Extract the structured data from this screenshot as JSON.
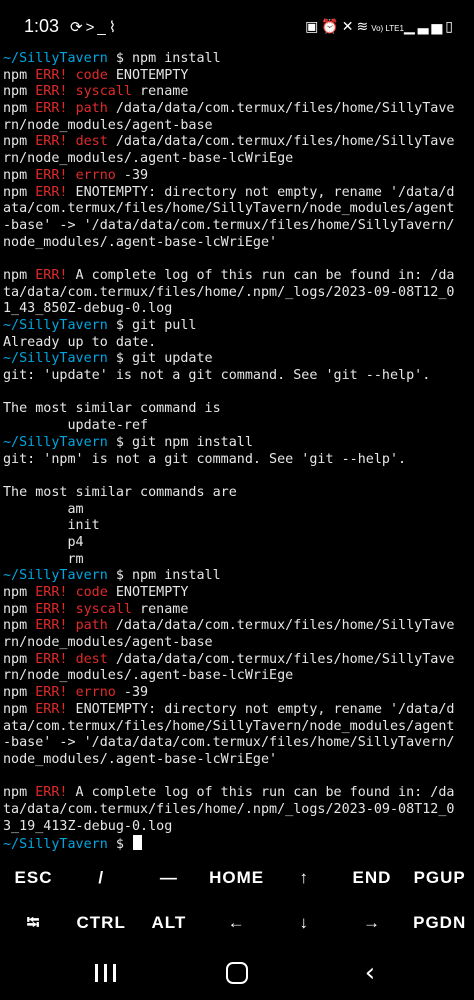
{
  "status_bar": {
    "time": "1:03",
    "left_icons": [
      "sync-icon",
      "terminal-icon",
      "paperclip-icon"
    ],
    "right_icons": [
      "battery-saver-icon",
      "alarm-icon",
      "mute-icon",
      "wifi-icon",
      "volte-icon",
      "signal-icon",
      "battery-icon"
    ],
    "network_label": "Vo) LTE1"
  },
  "terminal": {
    "prompt_path": "~/SillyTavern",
    "lines": [
      [
        {
          "t": "~/SillyTavern",
          "c": "prompt-path"
        },
        {
          "t": " $ npm install"
        }
      ],
      [
        {
          "t": "npm "
        },
        {
          "t": "ERR!",
          "c": "err-tag"
        },
        {
          "t": " "
        },
        {
          "t": "code",
          "c": "err-tag"
        },
        {
          "t": " ENOTEMPTY"
        }
      ],
      [
        {
          "t": "npm "
        },
        {
          "t": "ERR!",
          "c": "err-tag"
        },
        {
          "t": " "
        },
        {
          "t": "syscall",
          "c": "err-tag"
        },
        {
          "t": " rename"
        }
      ],
      [
        {
          "t": "npm "
        },
        {
          "t": "ERR!",
          "c": "err-tag"
        },
        {
          "t": " "
        },
        {
          "t": "path",
          "c": "err-tag"
        },
        {
          "t": " /data/data/com.termux/files/home/SillyTave"
        }
      ],
      [
        {
          "t": "rn/node_modules/agent-base"
        }
      ],
      [
        {
          "t": "npm "
        },
        {
          "t": "ERR!",
          "c": "err-tag"
        },
        {
          "t": " "
        },
        {
          "t": "dest",
          "c": "err-tag"
        },
        {
          "t": " /data/data/com.termux/files/home/SillyTave"
        }
      ],
      [
        {
          "t": "rn/node_modules/.agent-base-lcWriEge"
        }
      ],
      [
        {
          "t": "npm "
        },
        {
          "t": "ERR!",
          "c": "err-tag"
        },
        {
          "t": " "
        },
        {
          "t": "errno",
          "c": "err-tag"
        },
        {
          "t": " -39"
        }
      ],
      [
        {
          "t": "npm "
        },
        {
          "t": "ERR!",
          "c": "err-tag"
        },
        {
          "t": " ENOTEMPTY: directory not empty, rename '/data/d"
        }
      ],
      [
        {
          "t": "ata/com.termux/files/home/SillyTavern/node_modules/agent"
        }
      ],
      [
        {
          "t": "-base' -> '/data/data/com.termux/files/home/SillyTavern/"
        }
      ],
      [
        {
          "t": "node_modules/.agent-base-lcWriEge'"
        }
      ],
      [
        {
          "t": ""
        }
      ],
      [
        {
          "t": "npm "
        },
        {
          "t": "ERR!",
          "c": "err-tag"
        },
        {
          "t": " A complete log of this run can be found in: /da"
        }
      ],
      [
        {
          "t": "ta/data/com.termux/files/home/.npm/_logs/2023-09-08T12_0"
        }
      ],
      [
        {
          "t": "1_43_850Z-debug-0.log"
        }
      ],
      [
        {
          "t": "~/SillyTavern",
          "c": "prompt-path"
        },
        {
          "t": " $ git pull"
        }
      ],
      [
        {
          "t": "Already up to date."
        }
      ],
      [
        {
          "t": "~/SillyTavern",
          "c": "prompt-path"
        },
        {
          "t": " $ git update"
        }
      ],
      [
        {
          "t": "git: 'update' is not a git command. See 'git --help'."
        }
      ],
      [
        {
          "t": ""
        }
      ],
      [
        {
          "t": "The most similar command is"
        }
      ],
      [
        {
          "t": "        update-ref"
        }
      ],
      [
        {
          "t": "~/SillyTavern",
          "c": "prompt-path"
        },
        {
          "t": " $ git npm install"
        }
      ],
      [
        {
          "t": "git: 'npm' is not a git command. See 'git --help'."
        }
      ],
      [
        {
          "t": ""
        }
      ],
      [
        {
          "t": "The most similar commands are"
        }
      ],
      [
        {
          "t": "        am"
        }
      ],
      [
        {
          "t": "        init"
        }
      ],
      [
        {
          "t": "        p4"
        }
      ],
      [
        {
          "t": "        rm"
        }
      ],
      [
        {
          "t": "~/SillyTavern",
          "c": "prompt-path"
        },
        {
          "t": " $ npm install"
        }
      ],
      [
        {
          "t": "npm "
        },
        {
          "t": "ERR!",
          "c": "err-tag"
        },
        {
          "t": " "
        },
        {
          "t": "code",
          "c": "err-tag"
        },
        {
          "t": " ENOTEMPTY"
        }
      ],
      [
        {
          "t": "npm "
        },
        {
          "t": "ERR!",
          "c": "err-tag"
        },
        {
          "t": " "
        },
        {
          "t": "syscall",
          "c": "err-tag"
        },
        {
          "t": " rename"
        }
      ],
      [
        {
          "t": "npm "
        },
        {
          "t": "ERR!",
          "c": "err-tag"
        },
        {
          "t": " "
        },
        {
          "t": "path",
          "c": "err-tag"
        },
        {
          "t": " /data/data/com.termux/files/home/SillyTave"
        }
      ],
      [
        {
          "t": "rn/node_modules/agent-base"
        }
      ],
      [
        {
          "t": "npm "
        },
        {
          "t": "ERR!",
          "c": "err-tag"
        },
        {
          "t": " "
        },
        {
          "t": "dest",
          "c": "err-tag"
        },
        {
          "t": " /data/data/com.termux/files/home/SillyTave"
        }
      ],
      [
        {
          "t": "rn/node_modules/.agent-base-lcWriEge"
        }
      ],
      [
        {
          "t": "npm "
        },
        {
          "t": "ERR!",
          "c": "err-tag"
        },
        {
          "t": " "
        },
        {
          "t": "errno",
          "c": "err-tag"
        },
        {
          "t": " -39"
        }
      ],
      [
        {
          "t": "npm "
        },
        {
          "t": "ERR!",
          "c": "err-tag"
        },
        {
          "t": " ENOTEMPTY: directory not empty, rename '/data/d"
        }
      ],
      [
        {
          "t": "ata/com.termux/files/home/SillyTavern/node_modules/agent"
        }
      ],
      [
        {
          "t": "-base' -> '/data/data/com.termux/files/home/SillyTavern/"
        }
      ],
      [
        {
          "t": "node_modules/.agent-base-lcWriEge'"
        }
      ],
      [
        {
          "t": ""
        }
      ],
      [
        {
          "t": "npm "
        },
        {
          "t": "ERR!",
          "c": "err-tag"
        },
        {
          "t": " A complete log of this run can be found in: /da"
        }
      ],
      [
        {
          "t": "ta/data/com.termux/files/home/.npm/_logs/2023-09-08T12_0"
        }
      ],
      [
        {
          "t": "3_19_413Z-debug-0.log"
        }
      ],
      [
        {
          "t": "~/SillyTavern",
          "c": "prompt-path"
        },
        {
          "t": " $ "
        }
      ]
    ]
  },
  "extra_keys": {
    "row1": [
      {
        "label": "ESC",
        "name": "esc"
      },
      {
        "label": "/",
        "name": "slash"
      },
      {
        "label": "—",
        "name": "dash"
      },
      {
        "label": "HOME",
        "name": "home"
      },
      {
        "label": "↑",
        "name": "arrow-up"
      },
      {
        "label": "END",
        "name": "end"
      },
      {
        "label": "PGUP",
        "name": "pgup"
      }
    ],
    "row2": [
      {
        "label": "⭾",
        "name": "tab"
      },
      {
        "label": "CTRL",
        "name": "ctrl"
      },
      {
        "label": "ALT",
        "name": "alt"
      },
      {
        "label": "←",
        "name": "arrow-left"
      },
      {
        "label": "↓",
        "name": "arrow-down"
      },
      {
        "label": "→",
        "name": "arrow-right"
      },
      {
        "label": "PGDN",
        "name": "pgdn"
      }
    ]
  },
  "nav_bar": {
    "buttons": [
      "recent-apps-icon",
      "home-icon",
      "back-icon"
    ]
  },
  "colors": {
    "background": "#000000",
    "text": "#e6e6e6",
    "prompt": "#00a6e0",
    "error": "#e02a2a"
  }
}
